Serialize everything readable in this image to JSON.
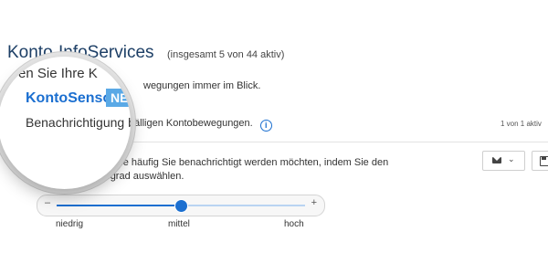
{
  "header": {
    "title": "Konto-InfoServices",
    "subtitle": "(insgesamt 5 von 44 aktiv)"
  },
  "intro": {
    "lead": "Behalten Sie Ihre Kontobe",
    "rest": "wegungen immer im Blick."
  },
  "service": {
    "name": "KontoSensor",
    "badge": "NEU",
    "description_lead": "Benachrichtigung b",
    "description_rest": "fälligen Kontobewegungen.",
    "info_icon": "info-icon",
    "counter": "1 von 1 aktiv"
  },
  "magnifier": {
    "line1": "en Sie Ihre K"
  },
  "setting": {
    "checked": true,
    "text": "Wählen Sie, wie häufig Sie benachrichtigt werden möchten, indem Sie den Sensitivitätsgrad auswählen."
  },
  "actions": {
    "mail_icon": "envelope-icon",
    "dropdown_icon": "chevron-down-icon",
    "save_icon": "save-icon"
  },
  "slider": {
    "minus": "–",
    "plus": "+",
    "value_fraction": 0.5,
    "labels": [
      "niedrig",
      "mittel",
      "hoch"
    ]
  },
  "colors": {
    "accent": "#1b6fd0",
    "badge": "#5aa9e6",
    "title": "#1d3f66"
  }
}
